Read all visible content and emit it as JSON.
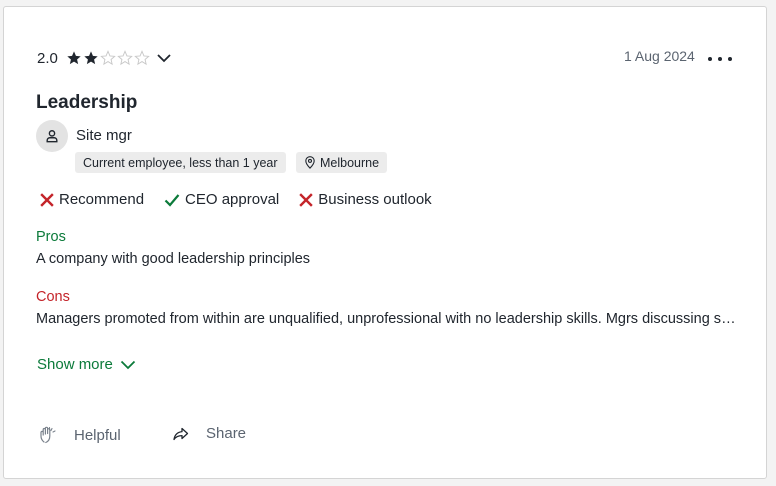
{
  "review": {
    "rating": "2.0",
    "stars_filled": 2,
    "stars_total": 5,
    "date": "1 Aug 2024",
    "title": "Leadership",
    "author": "Site mgr",
    "employment_tag": "Current employee, less than 1 year",
    "location_tag": "Melbourne",
    "sentiments": [
      {
        "label": "Recommend",
        "status": "negative"
      },
      {
        "label": "CEO approval",
        "status": "positive"
      },
      {
        "label": "Business outlook",
        "status": "negative"
      }
    ],
    "pros_label": "Pros",
    "pros_text": "A company with good leadership principles",
    "cons_label": "Cons",
    "cons_text": "Managers promoted from within are unqualified, unprofessional with no leadership skills. Mgrs discussing staff issues with other staff",
    "show_more_label": "Show more"
  },
  "actions": {
    "helpful_label": "Helpful",
    "share_label": "Share"
  },
  "colors": {
    "positive": "#0b7a3a",
    "negative": "#c4242a",
    "text": "#20262e",
    "muted": "#5b6470"
  },
  "icons": {
    "star": "star-icon",
    "chevron": "chevron-down-icon",
    "more": "more-options-icon",
    "user": "user-icon",
    "location": "location-pin-icon",
    "check": "check-icon",
    "cross": "x-icon",
    "helpful": "clapping-hands-icon",
    "share": "share-arrow-icon"
  }
}
